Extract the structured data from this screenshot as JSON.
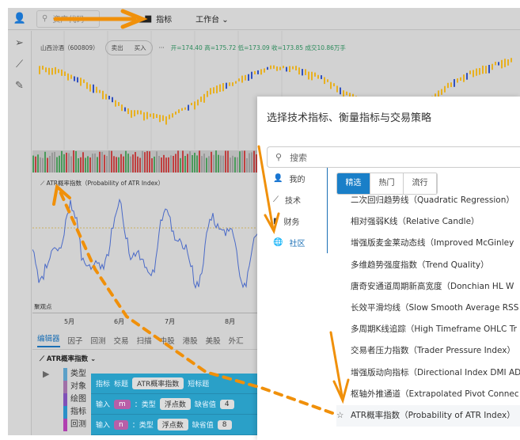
{
  "topbar": {
    "search_placeholder": "资产代码",
    "indicator_label": "指标",
    "workspace_label": "工作台"
  },
  "chart": {
    "stock": "山西汾酒（600809）",
    "sell": "卖出",
    "buy": "买入",
    "ohlc": "开=174.40 高=175.72 低=173.09 收=173.85 成交10.86万手"
  },
  "sub": {
    "title": "ATR概率指数（Probability of ATR Index）",
    "watermark": "聚观点"
  },
  "xaxis": [
    "5月",
    "6月",
    "7月",
    "8月"
  ],
  "tabs": [
    "编辑器",
    "因子",
    "回测",
    "交易",
    "扫描",
    "中股",
    "港股",
    "美股",
    "外汇"
  ],
  "editor": {
    "title": "ATR概率指数",
    "categories": [
      "类型",
      "对象",
      "绘图",
      "指标",
      "回测"
    ],
    "block": {
      "kw_indicator": "指标",
      "kw_title": "标题",
      "title_value": "ATR概率指数",
      "kw_short": "短标题",
      "kw_input": "输入",
      "kw_type": "：类型",
      "type_value": "浮点数",
      "kw_default": "缺省值",
      "inputs": [
        {
          "name": "m",
          "default": "4"
        },
        {
          "name": "n",
          "default": "8"
        }
      ]
    }
  },
  "modal": {
    "title": "选择技术指标、衡量指标与交易策略",
    "search_placeholder": "搜索",
    "side": [
      "我的",
      "技术",
      "财务",
      "社区"
    ],
    "tabs": [
      "精选",
      "热门",
      "流行"
    ],
    "items": [
      "二次回归趋势线（Quadratic Regression）",
      "相对强弱K线（Relative Candle）",
      "增强版麦金莱动态线（Improved McGinley",
      "多维趋势强度指数（Trend Quality）",
      "唐奇安通道周期新高宽度（Donchian HL W",
      "长效平滑均线（Slow Smooth Average RSS",
      "多周期K线追踪（High Timeframe OHLC Tr",
      "交易者压力指数（Trader Pressure Index）",
      "增强版动向指标（Directional Index DMI AD",
      "枢轴外推通道（Extrapolated Pivot Connec",
      "ATR概率指数（Probability of ATR Index）"
    ]
  },
  "colors": {
    "accent": "#1a7fc8",
    "arrow": "#f0900a",
    "up": "#e8b020",
    "down": "#3050c0"
  }
}
